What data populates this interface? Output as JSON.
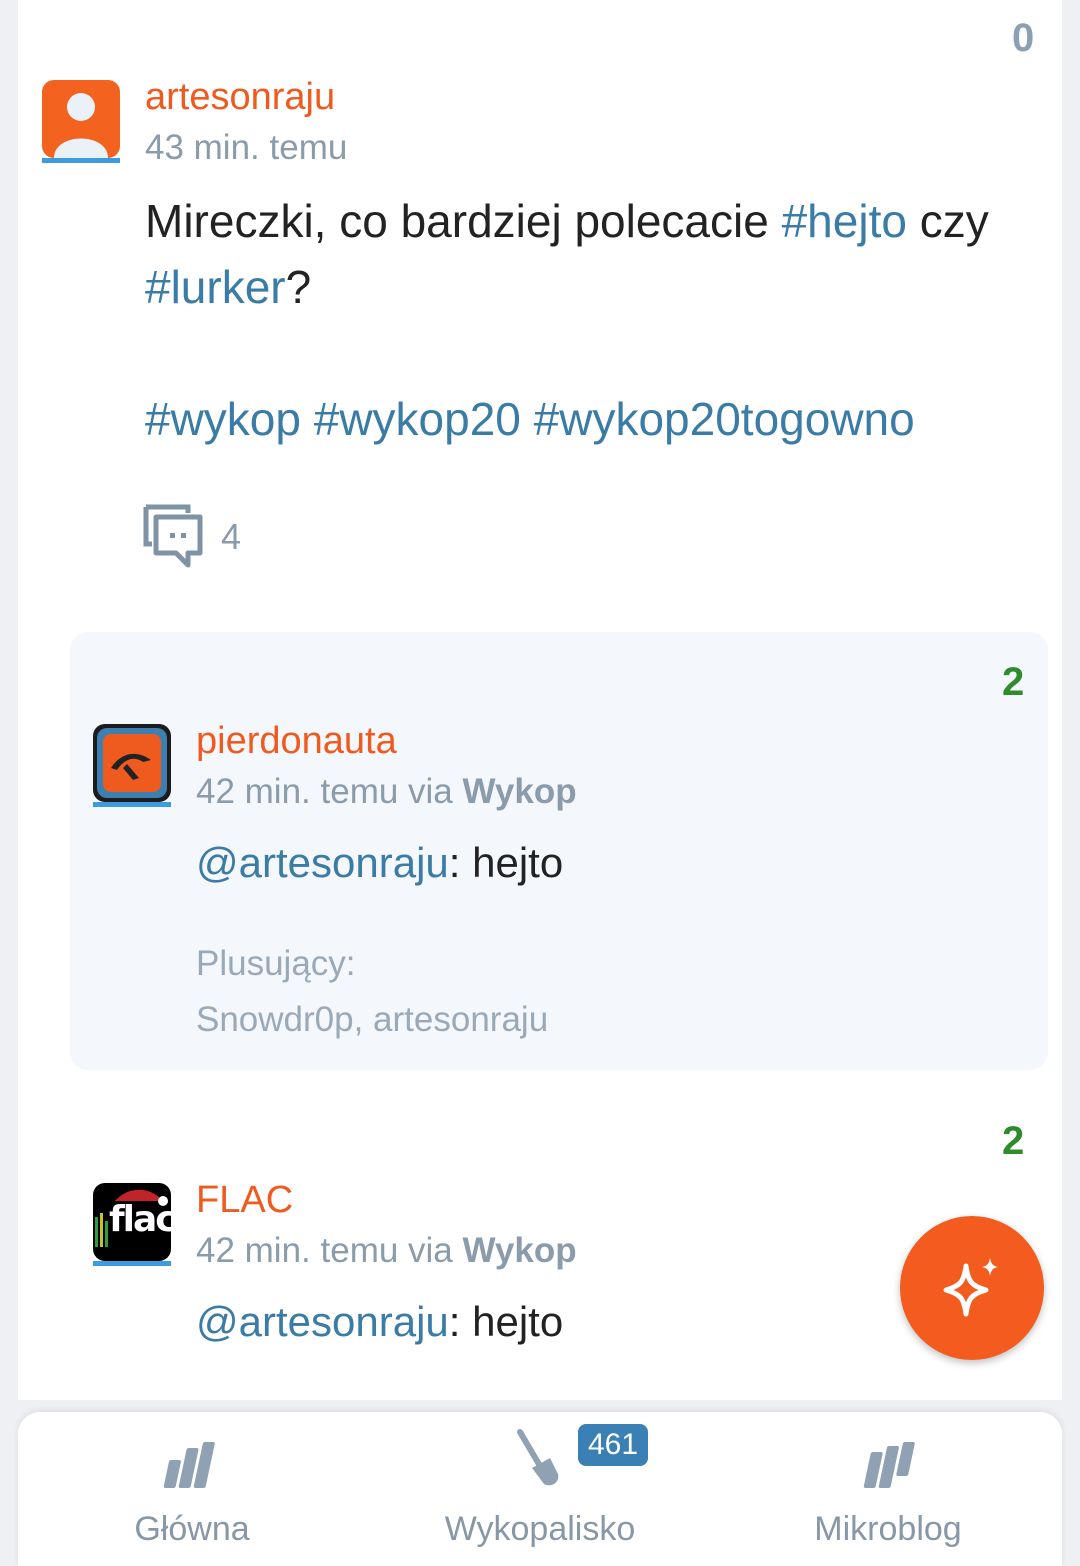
{
  "post": {
    "score": "0",
    "author": "artesonraju",
    "time": "43 min. temu",
    "line1_a": "Mireczki, co bardziej polecacie ",
    "tag1": "#hejto",
    "line1_b": " czy",
    "tag2": "#lurker",
    "line2_b": "?",
    "tags_line": [
      "#wykop",
      "#wykop20",
      "#wykop20togowno"
    ],
    "comment_count": "4"
  },
  "replies": [
    {
      "score": "2",
      "author": "pierdonauta",
      "time": "42 min. temu via",
      "via": "Wykop",
      "mention": "@artesonraju",
      "text": ": hejto",
      "plus_label": "Plusujący:",
      "plus_users": "Snowdr0p, artesonraju"
    },
    {
      "score": "2",
      "author": "FLAC",
      "time": "42 min. temu via",
      "via": "Wykop",
      "mention": "@artesonraju",
      "text": ": hejto",
      "avatar_text": "flac"
    }
  ],
  "nav": {
    "items": [
      {
        "label": "Główna",
        "icon": "home-w-icon"
      },
      {
        "label": "Wykopalisko",
        "icon": "shovel-icon",
        "badge": "461"
      },
      {
        "label": "Mikroblog",
        "icon": "microblog-m-icon"
      }
    ]
  },
  "colors": {
    "accent": "#ef5a1f",
    "link": "#3a7ca5",
    "score_positive": "#2e8b2e"
  }
}
